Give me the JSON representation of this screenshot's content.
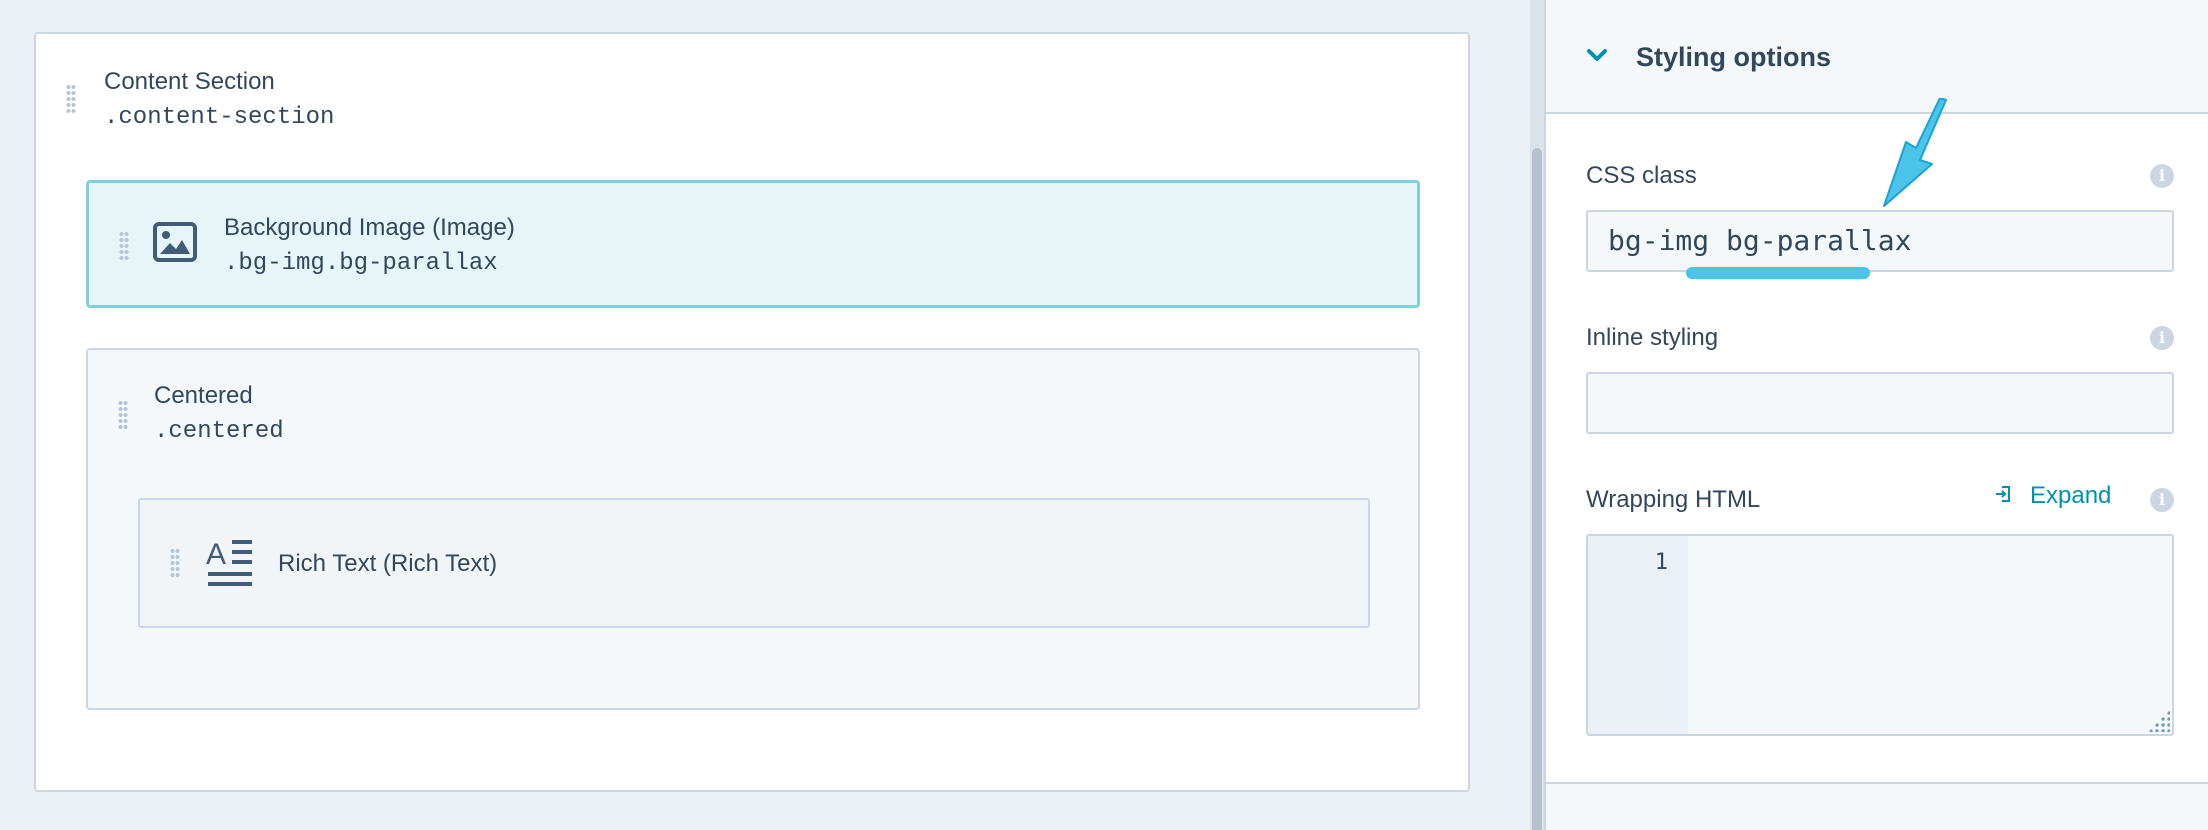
{
  "canvas": {
    "section": {
      "title": "Content Section",
      "class_name": ".content-section"
    },
    "background_image": {
      "title": "Background Image (Image)",
      "class_name": ".bg-img.bg-parallax",
      "icon": "image-icon"
    },
    "centered": {
      "title": "Centered",
      "class_name": ".centered"
    },
    "rich_text": {
      "title": "Rich Text (Rich Text)",
      "icon": "rich-text-icon"
    }
  },
  "panel": {
    "title": "Styling options",
    "css_class": {
      "label": "CSS class",
      "value": "bg-img bg-parallax",
      "highlighted_token": "bg-parallax"
    },
    "inline_styling": {
      "label": "Inline styling",
      "value": ""
    },
    "wrapping_html": {
      "label": "Wrapping HTML",
      "expand_label": "Expand",
      "line_numbers": [
        "1"
      ]
    }
  },
  "colors": {
    "accent": "#0091ae",
    "annotation": "#4cc3e9",
    "selected_fill": "#e5f5f8",
    "selected_border": "#7fd1de",
    "text": "#33475b",
    "border": "#cbd6e2"
  }
}
